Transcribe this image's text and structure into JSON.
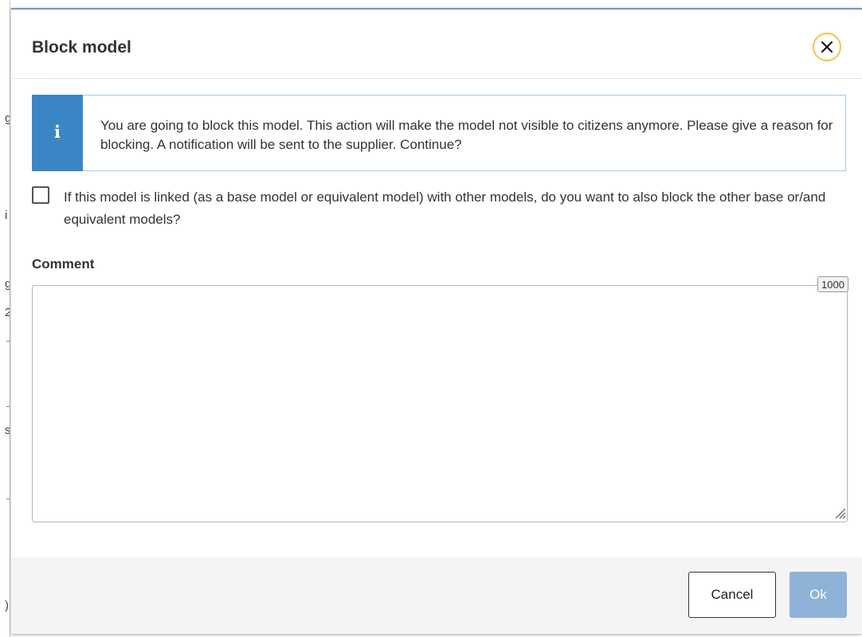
{
  "background": {
    "fragments": [
      "g",
      "i",
      "g",
      "2",
      "s",
      ")"
    ]
  },
  "modal": {
    "title": "Block model",
    "close_label": "Close",
    "alert": {
      "icon": "info-icon",
      "icon_glyph": "i",
      "text": "You are going to block this model. This action will make the model not visible to citizens anymore. Please give a reason for blocking. A notification will be sent to the supplier. Continue?"
    },
    "linked_checkbox": {
      "checked": false,
      "label": "If this model is linked (as a base model or equivalent model) with other models, do you want to also block the other base or/and equivalent models?"
    },
    "comment": {
      "label": "Comment",
      "value": "",
      "remaining_chars": "1000"
    },
    "footer": {
      "cancel_label": "Cancel",
      "ok_label": "Ok"
    }
  },
  "colors": {
    "info_accent": "#3a86c5",
    "close_ring": "#f0c64a",
    "ok_disabled": "#8fb2d8"
  }
}
